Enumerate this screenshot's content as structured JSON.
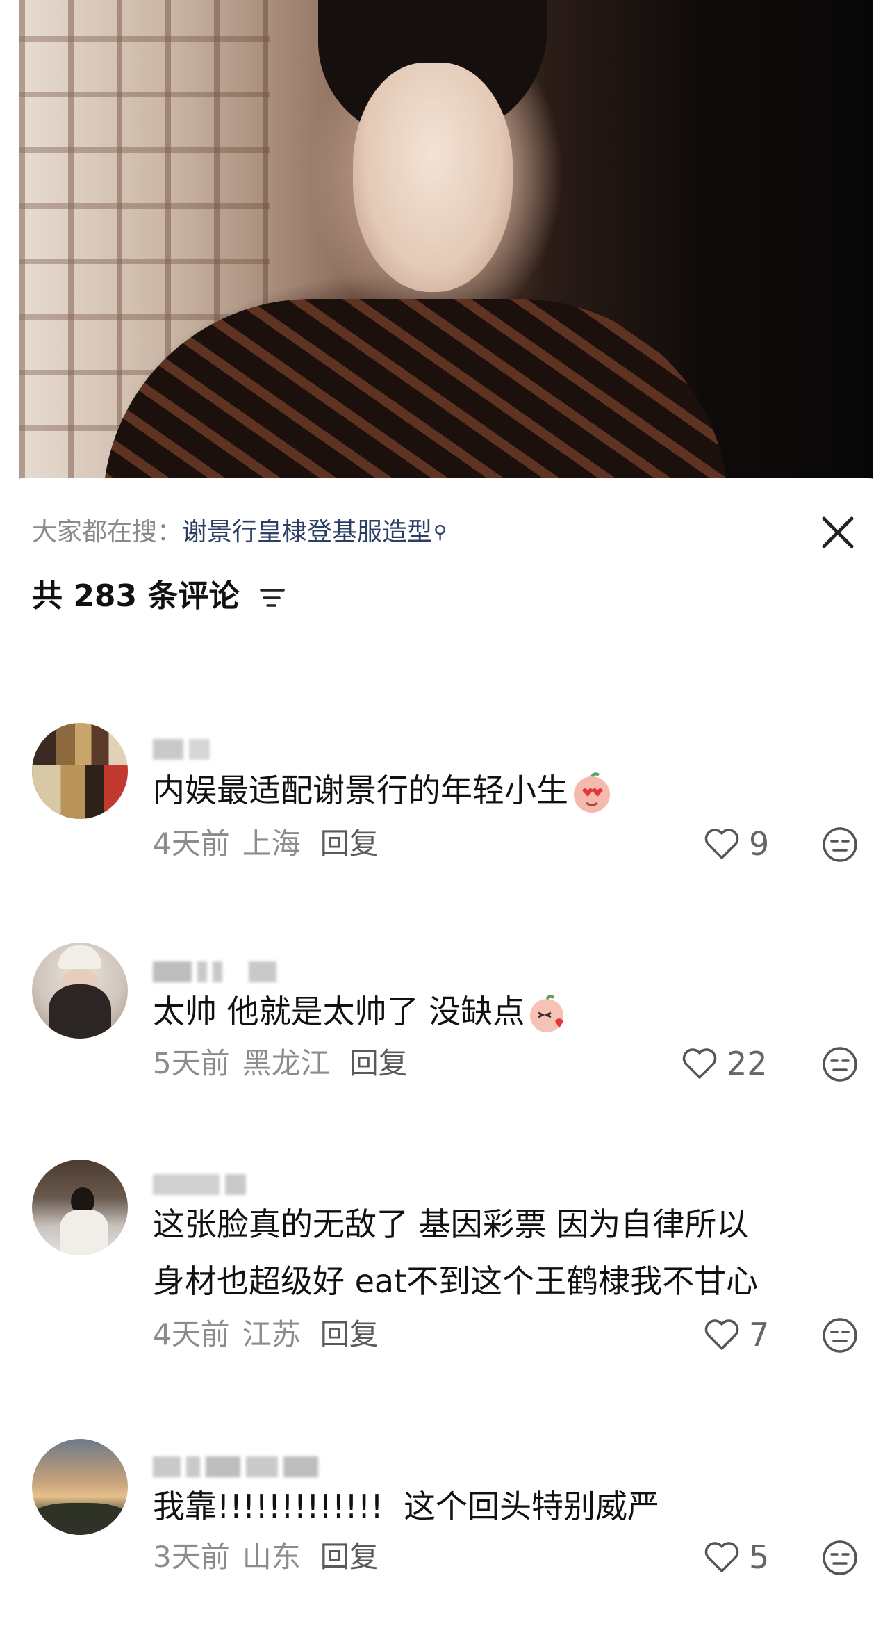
{
  "header": {
    "search_prefix": "大家都在搜：",
    "search_term": "谢景行皇棣登基服造型",
    "comment_count_label": "共 283 条评论"
  },
  "comments": [
    {
      "text": "内娱最适配谢景行的年轻小生",
      "time": "4天前",
      "location": "上海",
      "reply_label": "回复",
      "likes": "9",
      "emoji": "heart-eyes-emoji"
    },
    {
      "text": "太帅 他就是太帅了 没缺点",
      "time": "5天前",
      "location": "黑龙江",
      "reply_label": "回复",
      "likes": "22",
      "emoji": "kiss-emoji"
    },
    {
      "text_line1": "这张脸真的无敌了 基因彩票 因为自律所以",
      "text_line2": "身材也超级好 eat不到这个王鹤棣我不甘心",
      "time": "4天前",
      "location": "江苏",
      "reply_label": "回复",
      "likes": "7"
    },
    {
      "text": "我靠!!!!!!!!!!!!!  这个回头特别威严",
      "time": "3天前",
      "location": "山东",
      "reply_label": "回复",
      "likes": "5"
    }
  ],
  "icons": {
    "search": "search-icon",
    "close": "close-icon",
    "sort": "sort-icon",
    "like": "heart-icon",
    "dislike": "dislike-face-icon"
  },
  "colors": {
    "search_term": "#2b3e63",
    "meta_text": "#8c8c8c",
    "heart_outline": "#555555"
  }
}
